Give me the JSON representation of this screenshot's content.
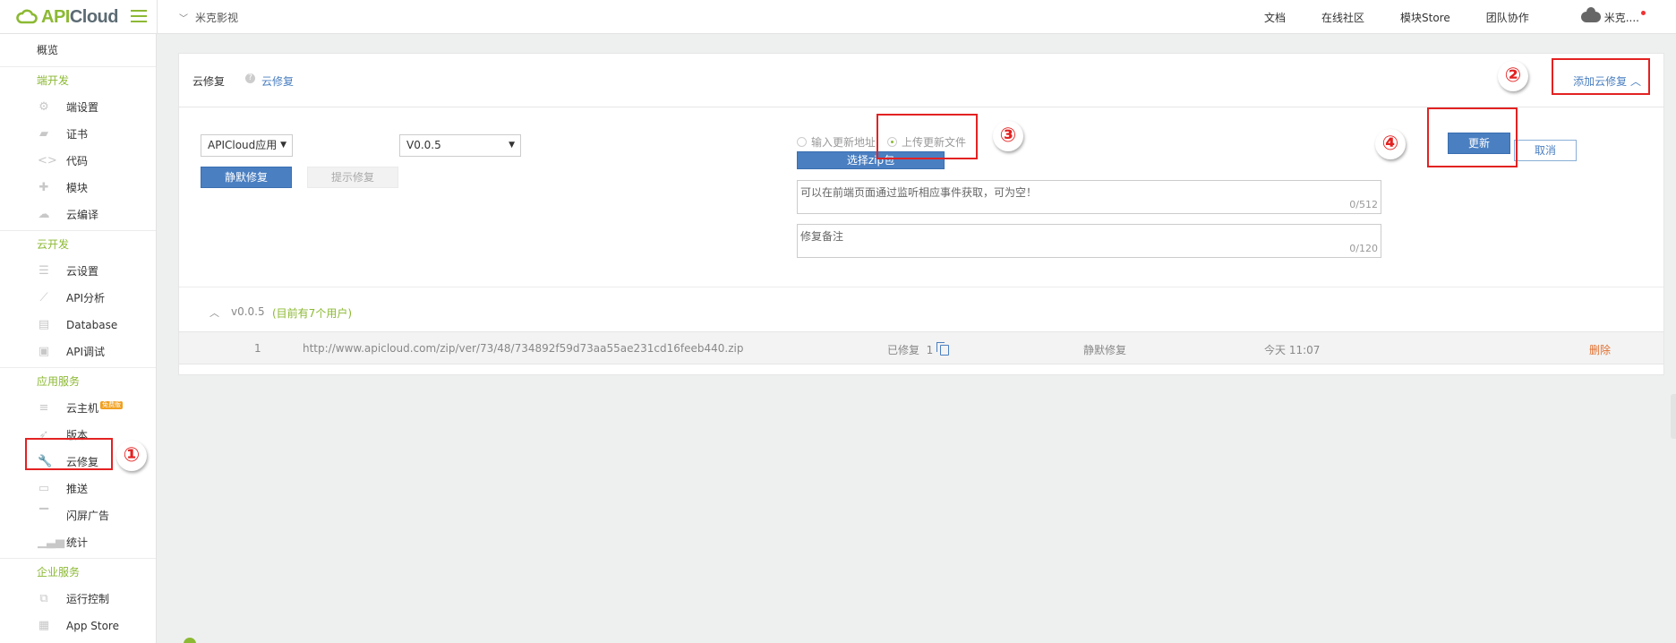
{
  "brand": {
    "name_prefix": "API",
    "name_suffix": "Cloud"
  },
  "topbar": {
    "app_name": "米克影视",
    "nav": [
      "文档",
      "在线社区",
      "模块Store",
      "团队协作"
    ],
    "user_name": "米克...."
  },
  "sidebar": {
    "overview": "概览",
    "groups": [
      {
        "title": "端开发",
        "items": [
          {
            "label": "端设置",
            "icon": "gear-icon"
          },
          {
            "label": "证书",
            "icon": "certificate-icon"
          },
          {
            "label": "代码",
            "icon": "code-icon"
          },
          {
            "label": "模块",
            "icon": "puzzle-icon"
          },
          {
            "label": "云编译",
            "icon": "cloud-icon"
          }
        ]
      },
      {
        "title": "云开发",
        "items": [
          {
            "label": "云设置",
            "icon": "sliders-icon"
          },
          {
            "label": "API分析",
            "icon": "chart-icon"
          },
          {
            "label": "Database",
            "icon": "database-icon"
          },
          {
            "label": "API调试",
            "icon": "debug-icon"
          }
        ]
      },
      {
        "title": "应用服务",
        "items": [
          {
            "label": "云主机",
            "icon": "server-icon",
            "badge": "免费版"
          },
          {
            "label": "版本",
            "icon": "rocket-icon"
          },
          {
            "label": "云修复",
            "icon": "wrench-icon",
            "active": true
          },
          {
            "label": "推送",
            "icon": "push-icon"
          },
          {
            "label": "闪屏广告",
            "icon": "billboard-icon"
          },
          {
            "label": "统计",
            "icon": "stats-icon"
          }
        ]
      },
      {
        "title": "企业服务",
        "items": [
          {
            "label": "运行控制",
            "icon": "control-icon"
          },
          {
            "label": "App Store",
            "icon": "store-icon"
          }
        ]
      }
    ]
  },
  "panel": {
    "title": "云修复",
    "help_link": "云修复",
    "add_fix": "添加云修复",
    "form": {
      "app_type": "APICloud应用",
      "version": "V0.0.5",
      "silent_fix": "静默修复",
      "prompt_fix": "提示修复",
      "radio_url": "输入更新地址",
      "radio_upload": "上传更新文件",
      "choose_zip": "选择zip包",
      "desc_placeholder": "可以在前端页面通过监听相应事件获取，可为空！",
      "desc_count": "0/512",
      "note_placeholder": "修复备注",
      "note_count": "0/120",
      "update": "更新",
      "cancel": "取消"
    },
    "version_group": {
      "version": "v0.0.5",
      "users": "(目前有7个用户)"
    },
    "fixes": [
      {
        "index": "1",
        "url": "http://www.apicloud.com/zip/ver/73/48/734892f59d73aa55ae231cd16feeb440.zip",
        "status": "已修复",
        "count": "1",
        "type": "静默修复",
        "time": "今天 11:07",
        "action": "删除"
      }
    ]
  },
  "annotations": [
    "①",
    "②",
    "③",
    "④"
  ],
  "colors": {
    "accent_green": "#8cb933",
    "link_blue": "#4a7fc1",
    "annotation_red": "#e32222",
    "delete_orange": "#e07030"
  }
}
